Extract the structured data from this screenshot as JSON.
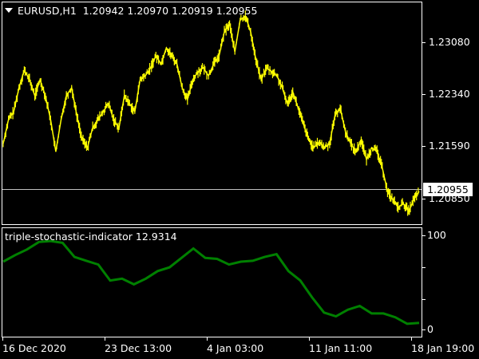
{
  "main_chart": {
    "symbol": "EURUSD,H1",
    "ohlc": "1.20942 1.20970 1.20919 1.20955",
    "current_price": "1.20955",
    "price_ticks": [
      "1.23080",
      "1.22340",
      "1.21590",
      "1.20850"
    ],
    "line_color": "#ffff00",
    "prices": [
      1.21635,
      1.21976,
      1.2209,
      1.22431,
      1.22682,
      1.22545,
      1.22318,
      1.22545,
      1.22318,
      1.21976,
      1.21521,
      1.21976,
      1.22318,
      1.22431,
      1.22033,
      1.21692,
      1.21578,
      1.21862,
      1.21976,
      1.2209,
      1.22204,
      1.21976,
      1.21862,
      1.22318,
      1.22204,
      1.2209,
      1.22545,
      1.22602,
      1.22716,
      1.22887,
      1.22773,
      1.23,
      1.22887,
      1.22773,
      1.22431,
      1.22261,
      1.22545,
      1.22659,
      1.22716,
      1.22602,
      1.22773,
      1.22887,
      1.23228,
      1.23342,
      1.22943,
      1.23399,
      1.23456,
      1.23228,
      1.2283,
      1.22545,
      1.22716,
      1.22659,
      1.22602,
      1.22431,
      1.22204,
      1.22374,
      1.22147,
      1.21919,
      1.21692,
      1.21578,
      1.21657,
      1.21578,
      1.21635,
      1.22033,
      1.22147,
      1.21806,
      1.21635,
      1.21521,
      1.21692,
      1.21407,
      1.21578,
      1.21521,
      1.21293,
      1.20952,
      1.20838,
      1.20724,
      1.20781,
      1.20667,
      1.20838,
      1.20955
    ]
  },
  "indicator": {
    "name": "triple-stochastic-indicator",
    "value": "12.9314",
    "scale_max": "100",
    "scale_min": "0",
    "line_color": "#008000",
    "values": [
      72,
      79,
      85,
      93,
      94,
      92,
      77,
      73,
      69,
      52,
      54,
      48,
      54,
      62,
      66,
      76,
      86,
      76,
      75,
      69,
      72,
      73,
      77,
      80,
      62,
      52,
      34,
      18,
      14,
      21,
      25,
      17,
      17,
      13,
      6,
      7
    ]
  },
  "time_axis": [
    "16 Dec 2020",
    "23 Dec 13:00",
    "4 Jan 03:00",
    "11 Jan 11:00",
    "18 Jan 19:00"
  ]
}
